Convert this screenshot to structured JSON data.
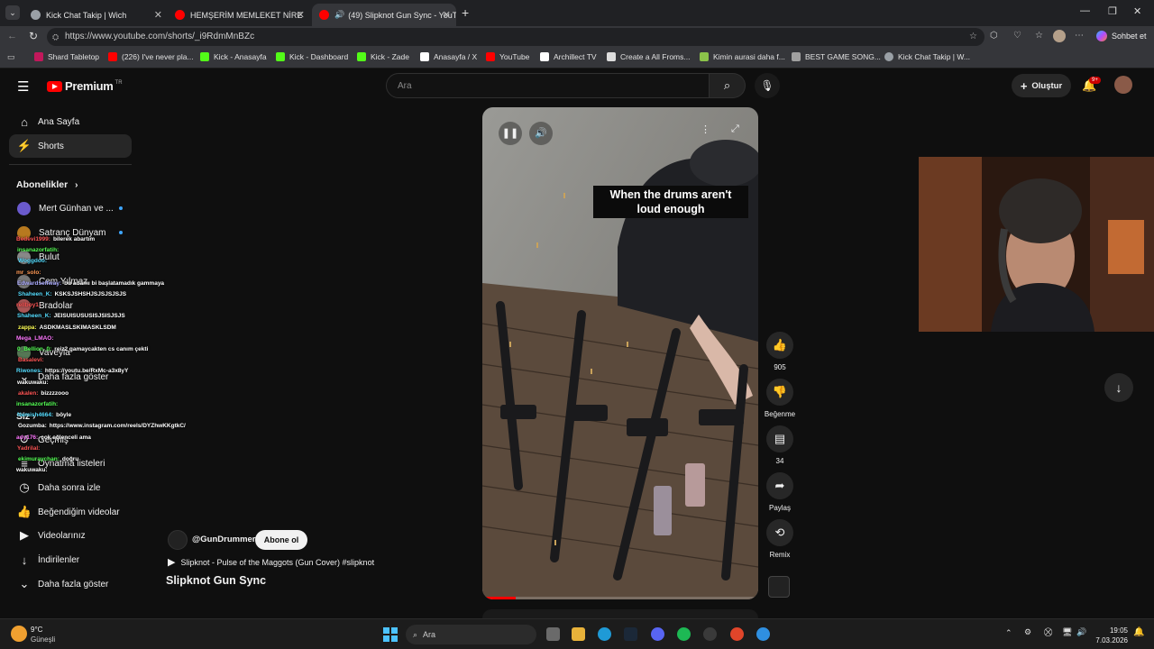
{
  "tabs": [
    {
      "label": "Kick Chat Takip | Wich",
      "color": "#9aa0a6"
    },
    {
      "label": "HEMŞERİM MEMLEKET NİRE",
      "color": "#ff0000"
    },
    {
      "label": "(49) Slipknot Gun Sync - YouT",
      "color": "#ff0000"
    }
  ],
  "address": {
    "url": "https://www.youtube.com/shorts/_i9RdmMnBZc",
    "copilot_label": "Sohbet et"
  },
  "bookmarks": [
    {
      "label": "Shard Tabletop",
      "color": "#c2185b"
    },
    {
      "label": "(226) I've never pla...",
      "color": "#ff0000"
    },
    {
      "label": "Kick - Anasayfa",
      "color": "#53fc18"
    },
    {
      "label": "Kick - Dashboard",
      "color": "#53fc18"
    },
    {
      "label": "Kick - Zade",
      "color": "#53fc18"
    },
    {
      "label": "Anasayfa / X",
      "color": "#ffffff"
    },
    {
      "label": "YouTube",
      "color": "#ff0000"
    },
    {
      "label": "Archillect TV",
      "color": "#ffffff"
    },
    {
      "label": "Create a All Froms...",
      "color": "#dddddd"
    },
    {
      "label": "Kimin aurasi daha f...",
      "color": "#8bc34a"
    },
    {
      "label": "BEST GAME SONG...",
      "color": "#a0a0a0"
    },
    {
      "label": "Kick Chat Takip | W...",
      "color": "#9aa0a6"
    }
  ],
  "yt": {
    "logo": "Premium",
    "logo_sup": "TR",
    "search_placeholder": "Ara",
    "create_label": "Oluştur",
    "notif_badge": "9+",
    "nav": [
      {
        "label": "Ana Sayfa",
        "icon": "home-icon"
      },
      {
        "label": "Shorts",
        "icon": "shorts-icon"
      }
    ],
    "subs_header": "Abonelikler",
    "subs": [
      {
        "label": "Mert Günhan ve ...",
        "color": "#6a5acd"
      },
      {
        "label": "Satranç Dünyam",
        "color": "#b7791f"
      },
      {
        "label": "Bulut",
        "color": "#888888"
      },
      {
        "label": "Cem Yılmaz",
        "color": "#777777"
      },
      {
        "label": "Bradolar",
        "color": "#aa5555"
      },
      {
        "label": "Vaveyla",
        "color": "#557755"
      }
    ],
    "more_subs": "Daha fazla göster",
    "you_header": "Siz",
    "you_items": [
      {
        "label": "Geçmiş",
        "icon": "history-icon"
      },
      {
        "label": "Oynatma listeleri",
        "icon": "playlist-icon"
      },
      {
        "label": "Daha sonra izle",
        "icon": "watch-later-icon"
      },
      {
        "label": "Beğendiğim videolar",
        "icon": "like-icon"
      },
      {
        "label": "Videolarınız",
        "icon": "video-icon"
      },
      {
        "label": "İndirilenler",
        "icon": "download-icon"
      },
      {
        "label": "Daha fazla göster",
        "icon": "chevron-down-icon"
      }
    ],
    "short": {
      "caption_line1": "When the drums aren't",
      "caption_line2": "loud enough",
      "channel": "@GunDrummer",
      "subscribe": "Abone ol",
      "sound": "Slipknot - Pulse of the Maggots (Gun Cover) #slipknot",
      "title": "Slipknot Gun Sync",
      "like_count": "905",
      "dislike_label": "Beğenme",
      "comment_count": "34",
      "share_label": "Paylaş",
      "remix_label": "Remix",
      "progress": 0.12
    }
  },
  "chat": [
    {
      "user": "Bedevi1999:",
      "msg": "bilerek abartım",
      "color": "#ff5555"
    },
    {
      "user": "insanazorfatih:",
      "msg": "",
      "color": "#55ff55"
    },
    {
      "user": "Woggdoo:",
      "msg": "",
      "color": "#55ddff"
    },
    {
      "user": "mr_solo:",
      "msg": "",
      "color": "#ff9955"
    },
    {
      "user": "Edwardselfway:",
      "msg": "bu adamı bi başlatamadık gammaya",
      "color": "#aaaaff"
    },
    {
      "user": "Shaheen_K:",
      "msg": "KSKSJSHSHJSJSJSJSJS",
      "color": "#55ddff"
    },
    {
      "user": "rellboy1:",
      "msg": "",
      "color": "#ff5555"
    },
    {
      "user": "Shaheen_K:",
      "msg": "JEISUISUSUSISJSISJSJS",
      "color": "#55ddff"
    },
    {
      "user": "zappa:",
      "msg": "ASDKMASLSKIMASKLSDM",
      "color": "#ffff55"
    },
    {
      "user": "Mega_LMAO:",
      "msg": "",
      "color": "#ff77ff"
    },
    {
      "user": "0_Bellion_0:",
      "msg": "reiz2 gamaycakten cs canım çekti",
      "color": "#55ff55"
    },
    {
      "user": "Basalevi:",
      "msg": "",
      "color": "#ff5555"
    },
    {
      "user": "Riwones:",
      "msg": "https://youtu.be/RxMc-a3x8yY",
      "color": "#55ddff"
    },
    {
      "user": "wakuwaku:",
      "msg": "",
      "color": "#ffffff"
    },
    {
      "user": "akalen:",
      "msg": "bizzzzooo",
      "color": "#ff5555"
    },
    {
      "user": "insanazorfatih:",
      "msg": "",
      "color": "#55ff55"
    },
    {
      "user": "Nemish4664:",
      "msg": "böyle",
      "color": "#55ddff"
    },
    {
      "user": "Gozumba:",
      "msg": "https://www.instagram.com/reels/DYZhwKKgtkC/",
      "color": "#ffffff"
    },
    {
      "user": "ady176:",
      "msg": "çok eğlenceli ama",
      "color": "#ff77ff"
    },
    {
      "user": "Yadrilal:",
      "msg": "",
      "color": "#ff5555"
    },
    {
      "user": "ekimuraychan:",
      "msg": "doğru",
      "color": "#55ff55"
    },
    {
      "user": "wakuwaku:",
      "msg": "",
      "color": "#ffffff"
    }
  ],
  "taskbar": {
    "weather_temp": "9°C",
    "weather_desc": "Güneşli",
    "search_label": "Ara",
    "time": "19:05",
    "date": "7.03.2026"
  }
}
